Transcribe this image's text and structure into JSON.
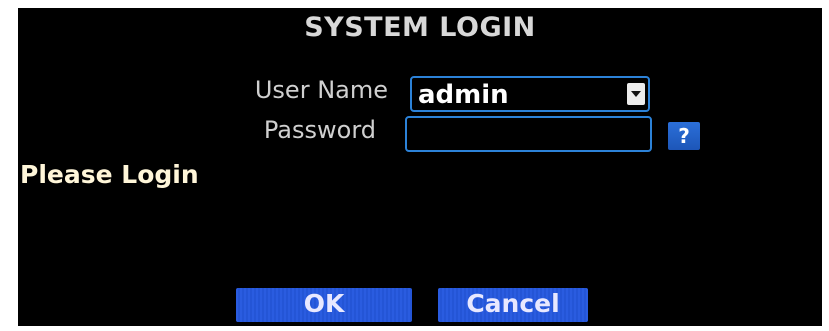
{
  "dialog": {
    "title": "SYSTEM LOGIN",
    "username_label": "User Name",
    "username_value": "admin",
    "password_label": "Password",
    "password_value": "",
    "help_label": "?",
    "status_text": "Please Login",
    "ok_label": "OK",
    "cancel_label": "Cancel"
  },
  "colors": {
    "background": "#000000",
    "field_border": "#2c82d8",
    "button_blue": "#2a5ce0",
    "status_text": "#fff6d9"
  },
  "icons": {
    "dropdown": "chevron-down-icon",
    "help": "question-icon"
  }
}
